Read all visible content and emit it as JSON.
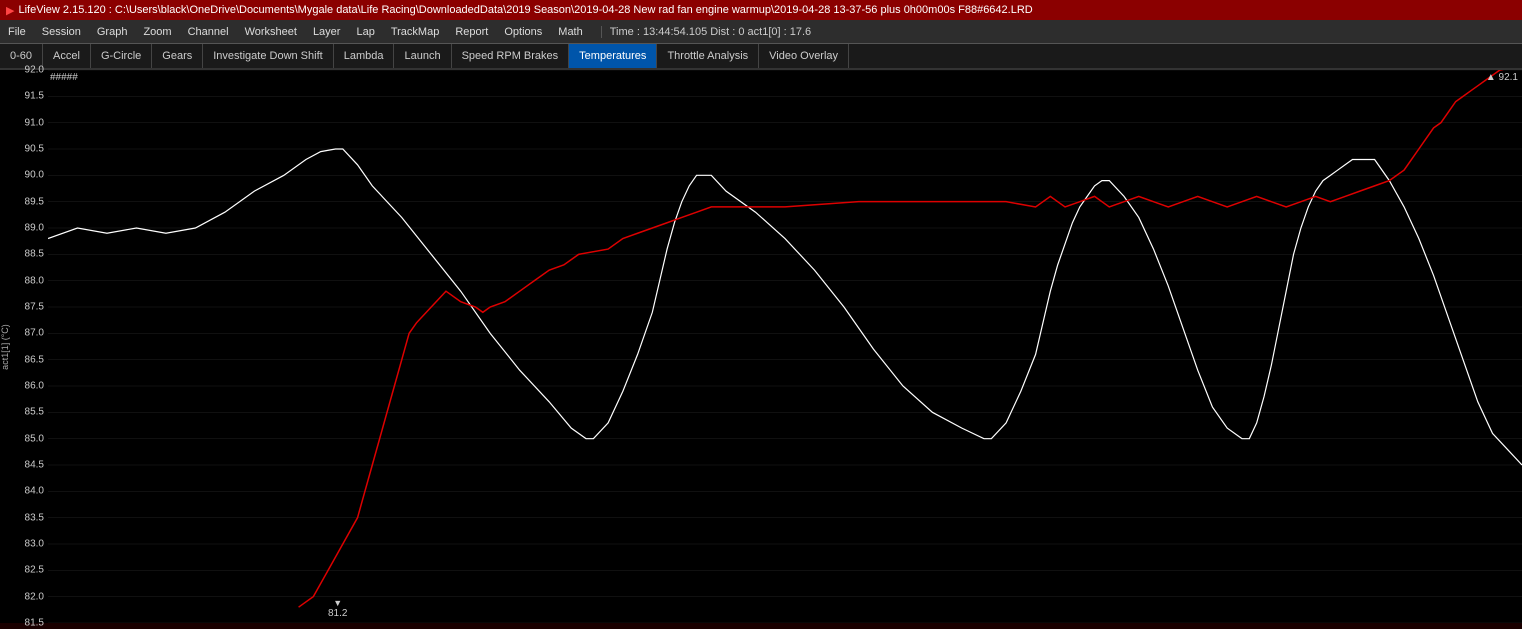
{
  "titleBar": {
    "appName": "LifeView 2.15.120",
    "filePath": "C:\\Users\\black\\OneDrive\\Documents\\Mygale data\\Life Racing\\DownloadedData\\2019 Season\\2019-04-28 New rad fan engine warmup\\2019-04-28 13-37-56 plus 0h00m00s F88#6642.LRD"
  },
  "menuBar": {
    "items": [
      "File",
      "Session",
      "Graph",
      "Zoom",
      "Channel",
      "Worksheet",
      "Layer",
      "Lap",
      "TrackMap",
      "Report",
      "Options",
      "Math"
    ],
    "status": "Time : 13:44:54.105   Dist : 0   act1[0] : 17.6"
  },
  "tabs": {
    "items": [
      "0-60",
      "Accel",
      "G-Circle",
      "Gears",
      "Investigate Down Shift",
      "Lambda",
      "Launch",
      "Speed RPM Brakes",
      "Temperatures",
      "Throttle Analysis",
      "Video Overlay"
    ],
    "active": "Temperatures"
  },
  "chart": {
    "hashLabel": "#####",
    "peakLabel": "▲ 92.1",
    "minLabel": "▼ 81.2",
    "yAxisTitle": "act1[1] (°C)",
    "yMin": 81.5,
    "yMax": 92.0,
    "yStep": 0.5,
    "yLabels": [
      "92.0",
      "91.5",
      "91.0",
      "90.5",
      "90.0",
      "89.5",
      "89.0",
      "88.5",
      "88.0",
      "87.5",
      "87.0",
      "86.5",
      "86.0",
      "85.5",
      "85.0",
      "84.5",
      "84.0",
      "83.5",
      "83.0",
      "82.5",
      "82.0",
      "81.5"
    ]
  }
}
